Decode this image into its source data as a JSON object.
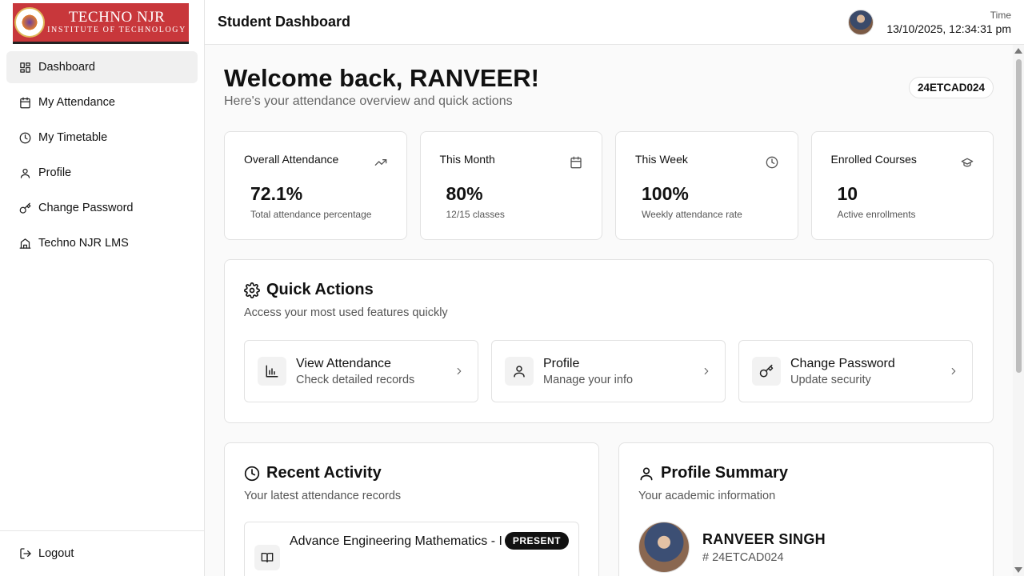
{
  "logo": {
    "line1": "TECHNO NJR",
    "line2": "INSTITUTE OF TECHNOLOGY"
  },
  "sidebar": {
    "items": [
      {
        "label": "Dashboard",
        "icon": "grid-icon",
        "active": true
      },
      {
        "label": "My Attendance",
        "icon": "calendar-icon"
      },
      {
        "label": "My Timetable",
        "icon": "clock-icon"
      },
      {
        "label": "Profile",
        "icon": "user-icon"
      },
      {
        "label": "Change Password",
        "icon": "key-icon"
      },
      {
        "label": "Techno NJR LMS",
        "icon": "building-icon"
      }
    ],
    "logout_label": "Logout"
  },
  "header": {
    "title": "Student Dashboard",
    "time_label": "Time",
    "time_value": "13/10/2025, 12:34:31 pm"
  },
  "welcome": {
    "title": "Welcome back, RANVEER!",
    "subtitle": "Here's your attendance overview and quick actions",
    "student_id": "24ETCAD024"
  },
  "stats": [
    {
      "label": "Overall Attendance",
      "value": "72.1%",
      "sub": "Total attendance percentage",
      "icon": "trending-up-icon"
    },
    {
      "label": "This Month",
      "value": "80%",
      "sub": "12/15 classes",
      "icon": "calendar-icon"
    },
    {
      "label": "This Week",
      "value": "100%",
      "sub": "Weekly attendance rate",
      "icon": "clock-icon"
    },
    {
      "label": "Enrolled Courses",
      "value": "10",
      "sub": "Active enrollments",
      "icon": "graduation-cap-icon"
    }
  ],
  "quick_actions": {
    "title": "Quick Actions",
    "subtitle": "Access your most used features quickly",
    "items": [
      {
        "title": "View Attendance",
        "desc": "Check detailed records",
        "icon": "bar-chart-icon"
      },
      {
        "title": "Profile",
        "desc": "Manage your info",
        "icon": "user-icon"
      },
      {
        "title": "Change Password",
        "desc": "Update security",
        "icon": "key-icon"
      }
    ]
  },
  "recent_activity": {
    "title": "Recent Activity",
    "subtitle": "Your latest attendance records",
    "items": [
      {
        "course": "Advance Engineering Mathematics - I",
        "status": "PRESENT"
      }
    ]
  },
  "profile_summary": {
    "title": "Profile Summary",
    "subtitle": "Your academic information",
    "name": "RANVEER SINGH",
    "id": "24ETCAD024"
  }
}
